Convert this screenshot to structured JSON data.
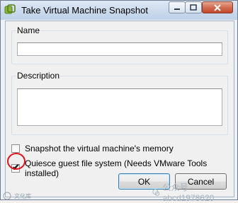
{
  "dialog": {
    "title": "Take Virtual Machine Snapshot",
    "name_label": "Name",
    "name_value": "",
    "description_label": "Description",
    "description_value": "",
    "options": [
      {
        "label": "Snapshot the virtual machine's memory",
        "checked": false
      },
      {
        "label": "Quiesce guest file system (Needs VMware Tools installed)",
        "checked": true
      }
    ],
    "ok_label": "OK",
    "cancel_label": "Cancel",
    "check_glyph": "✔"
  },
  "watermark": {
    "left_text": "文化库",
    "right_text": "公众号 · abcd1978620"
  },
  "colors": {
    "annotation_circle": "#e0141c",
    "close_button": "#c2462a"
  }
}
